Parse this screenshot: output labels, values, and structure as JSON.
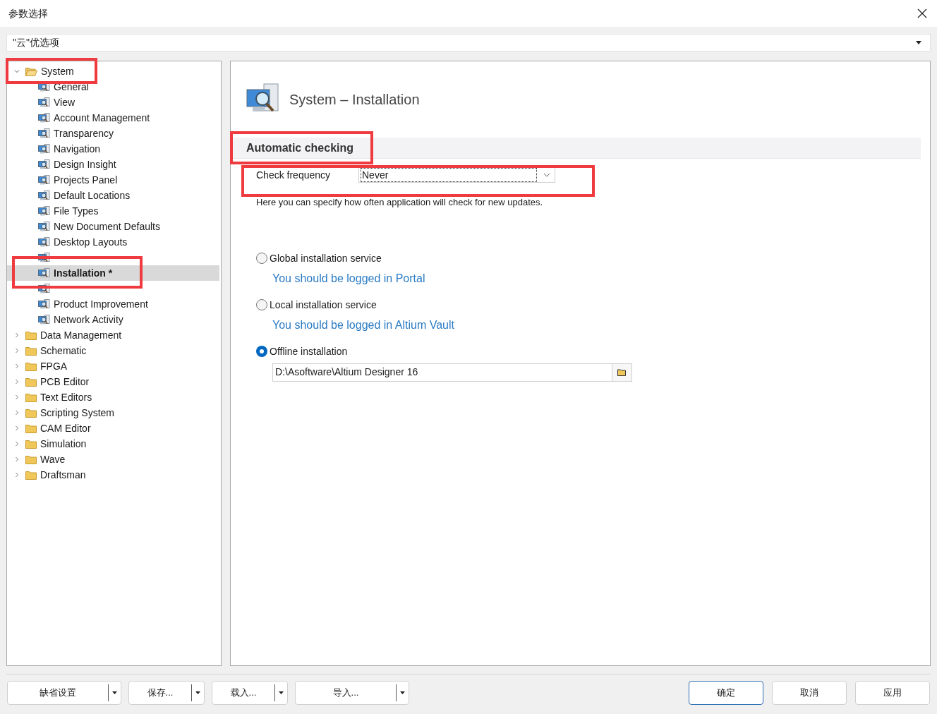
{
  "window": {
    "title": "参数选择"
  },
  "preset_dropdown": {
    "value": "\"云\"优选项"
  },
  "tree": [
    {
      "label": "System",
      "kind": "folder",
      "expanded": true,
      "selected": false,
      "children": [
        {
          "label": "General",
          "kind": "page",
          "selected": false
        },
        {
          "label": "View",
          "kind": "page",
          "selected": false
        },
        {
          "label": "Account Management",
          "kind": "page",
          "selected": false
        },
        {
          "label": "Transparency",
          "kind": "page",
          "selected": false
        },
        {
          "label": "Navigation",
          "kind": "page",
          "selected": false
        },
        {
          "label": "Design Insight",
          "kind": "page",
          "selected": false
        },
        {
          "label": "Projects Panel",
          "kind": "page",
          "selected": false
        },
        {
          "label": "Default Locations",
          "kind": "page",
          "selected": false
        },
        {
          "label": "File Types",
          "kind": "page",
          "selected": false
        },
        {
          "label": "New Document Defaults",
          "kind": "page",
          "selected": false
        },
        {
          "label": "Desktop Layouts",
          "kind": "page",
          "selected": false
        },
        {
          "kind": "page",
          "selected": false
        },
        {
          "label": "Installation *",
          "kind": "page",
          "selected": true
        },
        {
          "kind": "page",
          "selected": false
        },
        {
          "label": "Product Improvement",
          "kind": "page",
          "selected": false
        },
        {
          "label": "Network Activity",
          "kind": "page",
          "selected": false
        }
      ]
    },
    {
      "label": "Data Management",
      "kind": "folder",
      "expanded": false,
      "selected": false
    },
    {
      "label": "Schematic",
      "kind": "folder",
      "expanded": false,
      "selected": false
    },
    {
      "label": "FPGA",
      "kind": "folder",
      "expanded": false,
      "selected": false
    },
    {
      "label": "PCB Editor",
      "kind": "folder",
      "expanded": false,
      "selected": false
    },
    {
      "label": "Text Editors",
      "kind": "folder",
      "expanded": false,
      "selected": false
    },
    {
      "label": "Scripting System",
      "kind": "folder",
      "expanded": false,
      "selected": false
    },
    {
      "label": "CAM Editor",
      "kind": "folder",
      "expanded": false,
      "selected": false
    },
    {
      "label": "Simulation",
      "kind": "folder",
      "expanded": false,
      "selected": false
    },
    {
      "label": "Wave",
      "kind": "folder",
      "expanded": false,
      "selected": false
    },
    {
      "label": "Draftsman",
      "kind": "folder",
      "expanded": false,
      "selected": false
    }
  ],
  "page": {
    "title": "System – Installation",
    "section": "Automatic checking",
    "check_frequency": {
      "label": "Check frequency",
      "value": "Never"
    },
    "description": "Here you can specify how often application will check for new updates.",
    "options": [
      {
        "label": "Global installation service",
        "selected": false,
        "detail": {
          "kind": "link",
          "text": "You should be logged in Portal"
        }
      },
      {
        "label": "Local installation service",
        "selected": false,
        "detail": {
          "kind": "link",
          "text": "You should be logged in Altium Vault"
        }
      },
      {
        "label": "Offline installation",
        "selected": true,
        "detail": {
          "kind": "path",
          "value": "D:\\Asoftware\\Altium Designer 16"
        }
      }
    ]
  },
  "buttons": [
    {
      "label": "缺省设置",
      "kind": "split"
    },
    {
      "label": "保存...",
      "kind": "split"
    },
    {
      "label": "载入...",
      "kind": "split"
    },
    {
      "label": "导入...",
      "kind": "split"
    },
    {
      "label": "确定",
      "kind": "primary"
    },
    {
      "label": "取消",
      "kind": "plain"
    },
    {
      "label": "应用",
      "kind": "plain"
    }
  ]
}
